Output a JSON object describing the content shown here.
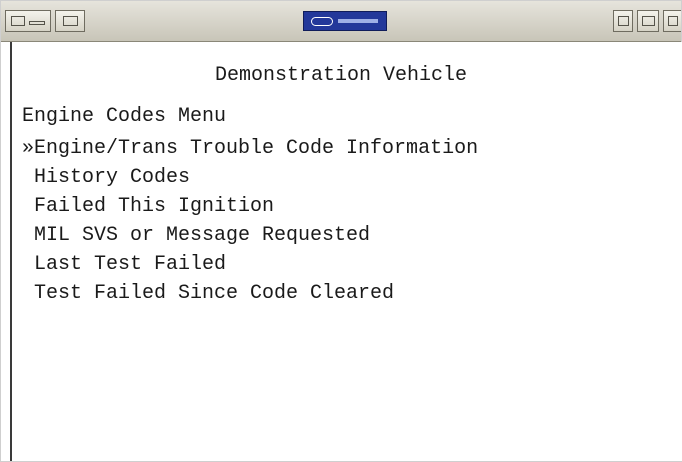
{
  "toolbar": {
    "icons": [
      "grid-icon",
      "meter-icon",
      "window-icon",
      "printer-icon",
      "document-icon"
    ],
    "logo": "brand-logo"
  },
  "screen": {
    "title": "Demonstration Vehicle",
    "menu_heading": "Engine Codes Menu",
    "selection_marker": "»",
    "items": [
      {
        "label": "Engine/Trans Trouble Code Information",
        "selected": true
      },
      {
        "label": "History Codes",
        "selected": false
      },
      {
        "label": "Failed This Ignition",
        "selected": false
      },
      {
        "label": "MIL SVS or Message Requested",
        "selected": false
      },
      {
        "label": "Last Test Failed",
        "selected": false
      },
      {
        "label": "Test Failed Since Code Cleared",
        "selected": false
      }
    ]
  }
}
